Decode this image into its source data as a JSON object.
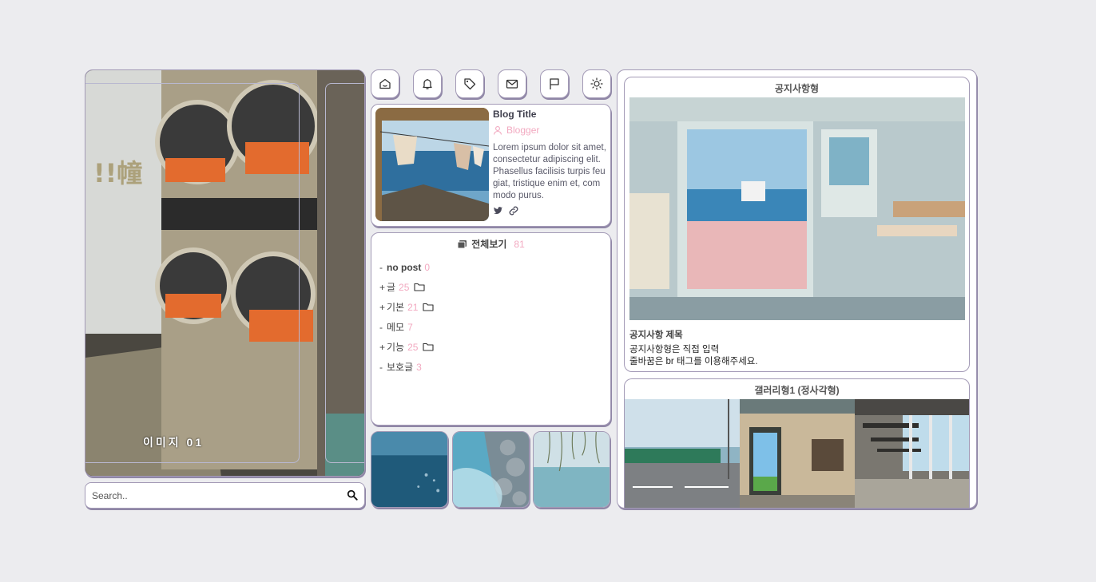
{
  "hero": {
    "caption": "이미지 01"
  },
  "search": {
    "placeholder": "Search.."
  },
  "nav_icons": [
    "home-icon",
    "bell-icon",
    "tag-icon",
    "mail-icon",
    "flag-icon",
    "sun-icon"
  ],
  "profile": {
    "title": "Blog Title",
    "blogger": "Blogger",
    "description": "Lorem ipsum dolor sit amet, consectetur adipiscing elit. Phasellus facilisis turpis feugiat, tristique enim et, commodo purus."
  },
  "category": {
    "header": "전체보기",
    "total": "81",
    "items": [
      {
        "prefix": "-",
        "name": "no post",
        "count": "0"
      },
      {
        "prefix": "+",
        "name": "글",
        "count": "25"
      },
      {
        "prefix": "+",
        "name": "기본",
        "count": "21"
      },
      {
        "prefix": "-",
        "name": "메모",
        "count": "7"
      },
      {
        "prefix": "+",
        "name": "기능",
        "count": "25"
      },
      {
        "prefix": "-",
        "name": "보호글",
        "count": "3"
      }
    ]
  },
  "notice": {
    "section_title": "공지사항형",
    "title": "공지사항 제목",
    "line1": "공지사항형은 직접 입력",
    "line2": "줄바꿈은 br 태그를 이용해주세요."
  },
  "gallery": {
    "section_title": "갤러리형1 (정사각형)"
  },
  "colors": {
    "accent_pink": "#f2a9c0",
    "border": "#a39ab6",
    "background": "#ececef"
  }
}
